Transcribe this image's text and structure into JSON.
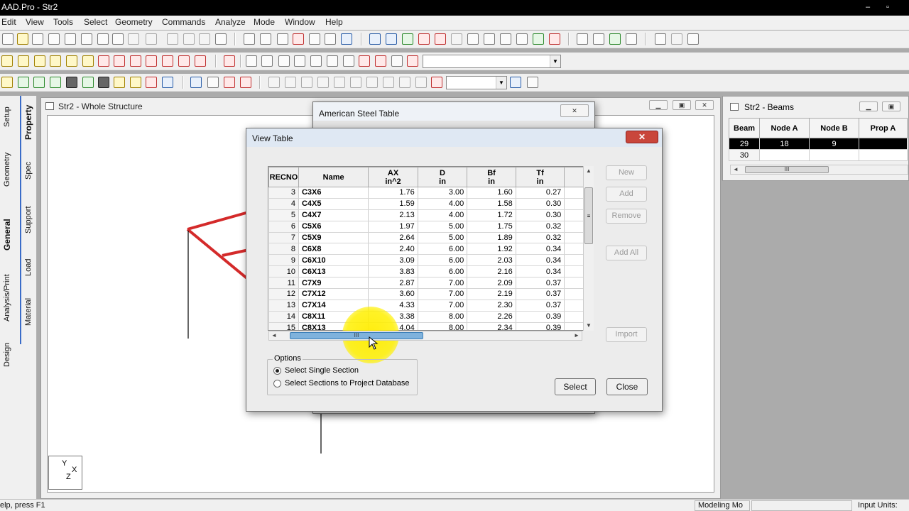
{
  "app": {
    "title": "AAD.Pro - Str2",
    "min": "–",
    "max": "▫",
    "menu": [
      "Edit",
      "View",
      "Tools",
      "Select",
      "Geometry",
      "Commands",
      "Analyze",
      "Mode",
      "Window",
      "Help"
    ]
  },
  "side_tabs": {
    "outer": [
      "Setup",
      "Geometry",
      "General",
      "Analysis/Print",
      "Design"
    ],
    "inner": [
      "Property",
      "Spec",
      "Support",
      "Load",
      "Material"
    ]
  },
  "structure_window": {
    "title": "Str2 - Whole Structure",
    "axis_label": "Y",
    "axis_label2": "X",
    "axis_label3": "Z"
  },
  "beams_window": {
    "title": "Str2 - Beams",
    "columns": [
      "Beam",
      "Node A",
      "Node B",
      "Prop A"
    ],
    "rows": [
      [
        "29",
        "18",
        "9",
        ""
      ],
      [
        "30",
        "",
        "",
        ""
      ]
    ],
    "scroll_thumb": "III"
  },
  "american_dialog": {
    "title": "American Steel Table",
    "close": "✕"
  },
  "view_table": {
    "title": "View Table",
    "close": "✕",
    "columns": [
      {
        "top": "RECNO",
        "bottom": ""
      },
      {
        "top": "Name",
        "bottom": ""
      },
      {
        "top": "AX",
        "bottom": "in^2"
      },
      {
        "top": "D",
        "bottom": "in"
      },
      {
        "top": "Bf",
        "bottom": "in"
      },
      {
        "top": "Tf",
        "bottom": "in"
      }
    ],
    "rows": [
      [
        "3",
        "C3X6",
        "1.76",
        "3.00",
        "1.60",
        "0.27"
      ],
      [
        "4",
        "C4X5",
        "1.59",
        "4.00",
        "1.58",
        "0.30"
      ],
      [
        "5",
        "C4X7",
        "2.13",
        "4.00",
        "1.72",
        "0.30"
      ],
      [
        "6",
        "C5X6",
        "1.97",
        "5.00",
        "1.75",
        "0.32"
      ],
      [
        "7",
        "C5X9",
        "2.64",
        "5.00",
        "1.89",
        "0.32"
      ],
      [
        "8",
        "C6X8",
        "2.40",
        "6.00",
        "1.92",
        "0.34"
      ],
      [
        "9",
        "C6X10",
        "3.09",
        "6.00",
        "2.03",
        "0.34"
      ],
      [
        "10",
        "C6X13",
        "3.83",
        "6.00",
        "2.16",
        "0.34"
      ],
      [
        "11",
        "C7X9",
        "2.87",
        "7.00",
        "2.09",
        "0.37"
      ],
      [
        "12",
        "C7X12",
        "3.60",
        "7.00",
        "2.19",
        "0.37"
      ],
      [
        "13",
        "C7X14",
        "4.33",
        "7.00",
        "2.30",
        "0.37"
      ],
      [
        "14",
        "C8X11",
        "3.38",
        "8.00",
        "2.26",
        "0.39"
      ],
      [
        "15",
        "C8X13",
        "4.04",
        "8.00",
        "2.34",
        "0.39"
      ]
    ],
    "hscroll_thumb": "III",
    "vscroll_thumb": "≡",
    "side_buttons": [
      "New",
      "Add",
      "Remove",
      "Add All",
      "Import"
    ],
    "options_legend": "Options",
    "options": [
      {
        "label": "Select Single Section",
        "selected": true
      },
      {
        "label": "Select Sections to Project Database",
        "selected": false
      }
    ],
    "select_button": "Select",
    "close_button": "Close"
  },
  "status": {
    "help": "elp, press F1",
    "mode": "Modeling Mo",
    "units": "Input Units:"
  }
}
